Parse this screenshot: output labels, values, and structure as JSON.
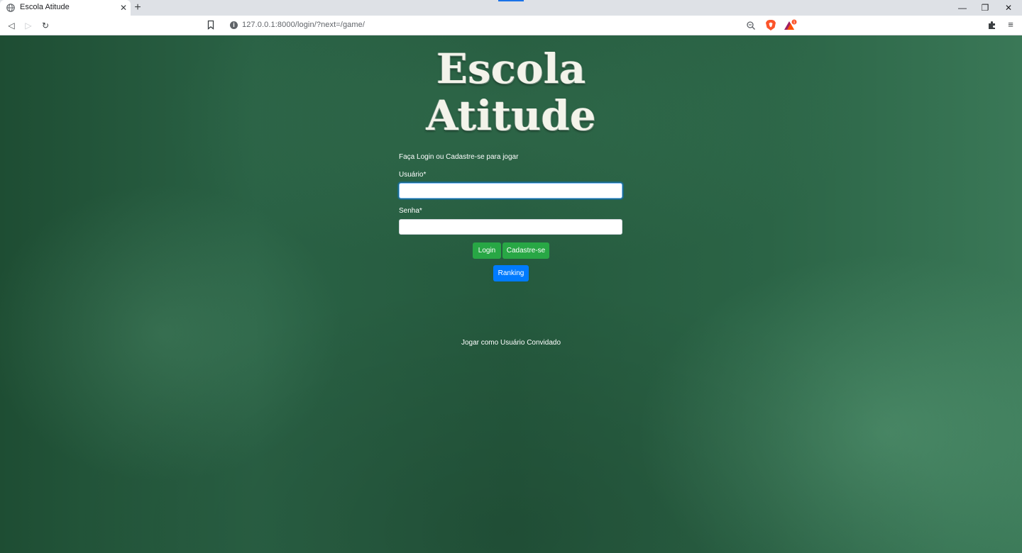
{
  "browser": {
    "tab_title": "Escola Atitude",
    "tab_close": "✕",
    "new_tab": "+",
    "url": "127.0.0.1:8000/login/?next=/game/",
    "info_glyph": "i",
    "window_controls": {
      "minimize": "—",
      "restore": "❐",
      "close": "✕"
    },
    "nav": {
      "back": "◁",
      "forward": "▷",
      "reload": "↻"
    },
    "menu": "≡",
    "icons": [
      "globe-icon",
      "bookmark-icon",
      "info-icon",
      "zoom-icon",
      "brave-shield-icon",
      "brave-rewards-icon",
      "extensions-icon",
      "menu-icon"
    ]
  },
  "page": {
    "logo_line1": "Escola",
    "logo_line2": "Atitude",
    "intro": "Faça Login ou Cadastre-se para jogar",
    "username_label": "Usuário*",
    "username_value": "",
    "password_label": "Senha*",
    "password_value": "",
    "login_button": "Login",
    "signup_button": "Cadastre-se",
    "ranking_button": "Ranking",
    "guest_link": "Jogar como Usuário Convidado",
    "colors": {
      "chalkboard": "#255b3e",
      "success": "#28a745",
      "primary": "#007bff"
    }
  }
}
